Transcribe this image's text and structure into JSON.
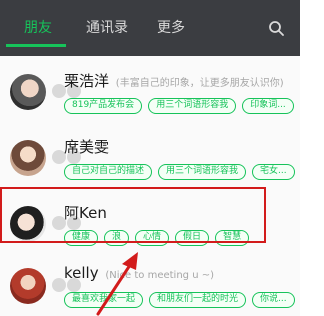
{
  "header": {
    "tabs": [
      {
        "label": "朋友",
        "active": true
      },
      {
        "label": "通讯录",
        "active": false
      },
      {
        "label": "更多",
        "active": false
      }
    ],
    "accent_color": "#16c35a",
    "search_icon": "search-icon"
  },
  "friends": [
    {
      "name": "栗浩洋",
      "signature": "(丰富自己的印象，让更多朋友认识你)",
      "tags": [
        "819产品发布会",
        "用三个词语形容我",
        "印象词..."
      ]
    },
    {
      "name": "席美雯",
      "signature": "",
      "tags": [
        "自己对自己的描述",
        "用三个词语形容我",
        "宅女..."
      ]
    },
    {
      "name": "阿Ken",
      "signature": "",
      "tags": [
        "健康",
        "浪",
        "心情",
        "假日",
        "智慧"
      ]
    },
    {
      "name": "kelly",
      "signature": "(Nice to meeting u ~)",
      "tags": [
        "最喜欢我家一起",
        "和朋友们一起的时光",
        "你说..."
      ]
    }
  ],
  "highlight_color": "#d21b1b"
}
